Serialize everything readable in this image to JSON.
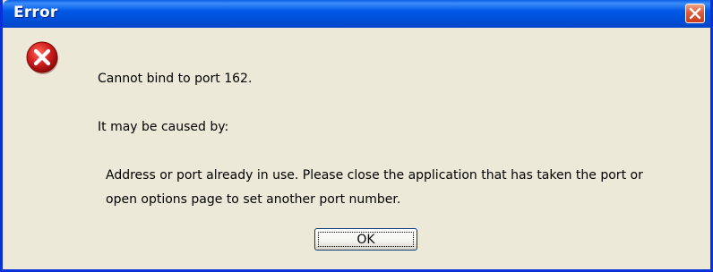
{
  "window": {
    "title": "Error",
    "close_icon": "close-icon"
  },
  "message": {
    "icon": "error-icon",
    "line1": "Cannot bind to port 162.",
    "line2": "It may be caused by:",
    "line3": "Address or port already in use. Please close the application that has taken the port or",
    "line4": "open options page to set another port number."
  },
  "buttons": {
    "ok_label": "OK"
  },
  "colors": {
    "titlebar": "#0058e6",
    "close_button": "#e0603e",
    "dialog_background": "#ece9d8",
    "error_icon": "#d42020"
  }
}
